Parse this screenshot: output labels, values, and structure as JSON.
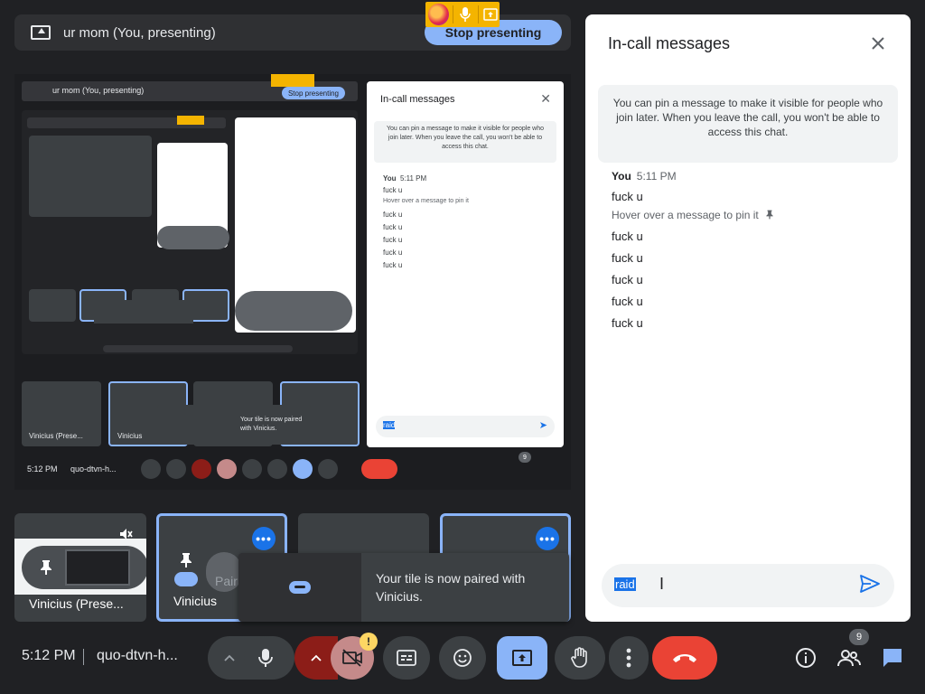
{
  "presenting_bar": {
    "label": "ur mom (You, presenting)",
    "stop_button": "Stop presenting"
  },
  "nested_preview": {
    "bar_label": "ur mom (You, presenting)",
    "stop_button": "Stop presenting",
    "chat_title": "In-call messages",
    "chat_info": "You can pin a message to make it visible for people who join later. When you leave the call, you won't be able to access this chat.",
    "sender": "You",
    "time": "5:11 PM",
    "messages": [
      "fuck u",
      "fuck u",
      "fuck u",
      "fuck u",
      "fuck u",
      "fuck u"
    ],
    "hint": "Hover over a message to pin it",
    "input_value": "raid",
    "time_bottom": "5:12 PM",
    "code_bottom": "quo-dtvn-h...",
    "tile_names": [
      "Vinicius (Prese...",
      "Vinicius"
    ],
    "toast": "Your tile is now paired with Vinicius.",
    "people_count": "9"
  },
  "tiles": [
    {
      "name": "Vinicius (Prese..."
    },
    {
      "name": "Vinicius",
      "overlay": "Pair"
    },
    {
      "name": ""
    },
    {
      "name": ""
    }
  ],
  "toast": {
    "text": "Your tile is now paired with Vinicius."
  },
  "chat": {
    "title": "In-call messages",
    "info": "You can pin a message to make it visible for people who join later. When you leave the call, you won't be able to access this chat.",
    "sender": "You",
    "timestamp": "5:11 PM",
    "first_message": "fuck u",
    "hint": "Hover over a message to pin it",
    "messages": [
      "fuck u",
      "fuck u",
      "fuck u",
      "fuck u",
      "fuck u"
    ],
    "input_value": "raid"
  },
  "bottom_bar": {
    "time": "5:12 PM",
    "meeting_code": "quo-dtvn-h...",
    "warning_badge": "!",
    "people_count": "9"
  },
  "colors": {
    "background": "#202124",
    "accent_blue": "#8ab4f8",
    "end_call_red": "#ea4335",
    "firefox_sharing": "#f4b400"
  }
}
